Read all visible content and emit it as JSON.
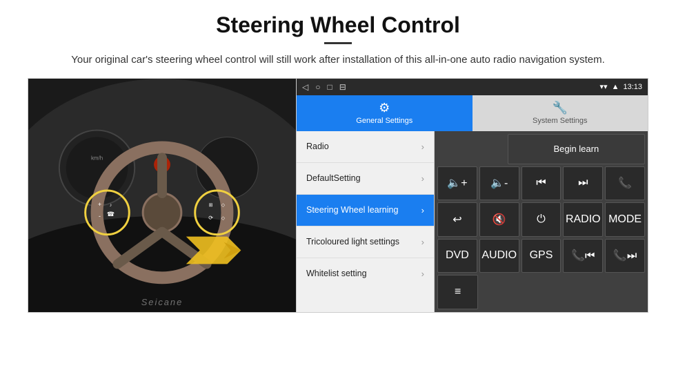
{
  "page": {
    "title": "Steering Wheel Control",
    "subtitle": "Your original car's steering wheel control will still work after installation of this all-in-one auto radio navigation system."
  },
  "status_bar": {
    "time": "13:13",
    "nav_icons": [
      "◁",
      "○",
      "□",
      "⊟"
    ]
  },
  "tabs": [
    {
      "id": "general",
      "label": "General Settings",
      "icon": "⚙",
      "active": true
    },
    {
      "id": "system",
      "label": "System Settings",
      "icon": "🔧",
      "active": false
    }
  ],
  "menu_items": [
    {
      "id": "radio",
      "label": "Radio",
      "active": false
    },
    {
      "id": "default",
      "label": "DefaultSetting",
      "active": false
    },
    {
      "id": "steering",
      "label": "Steering Wheel learning",
      "active": true
    },
    {
      "id": "tricoloured",
      "label": "Tricoloured light settings",
      "active": false
    },
    {
      "id": "whitelist",
      "label": "Whitelist setting",
      "active": false
    }
  ],
  "buttons": {
    "begin_learn": "Begin learn",
    "row1": [
      "🔈+",
      "🔈-",
      "⏮",
      "⏭",
      "📞"
    ],
    "row2": [
      "↩",
      "🔇",
      "⏻",
      "RADIO",
      "MODE"
    ],
    "row3": [
      "DVD",
      "AUDIO",
      "GPS",
      "📞⏮",
      "📞⏭"
    ],
    "row4": [
      "≡"
    ]
  },
  "watermark": "Seicane"
}
